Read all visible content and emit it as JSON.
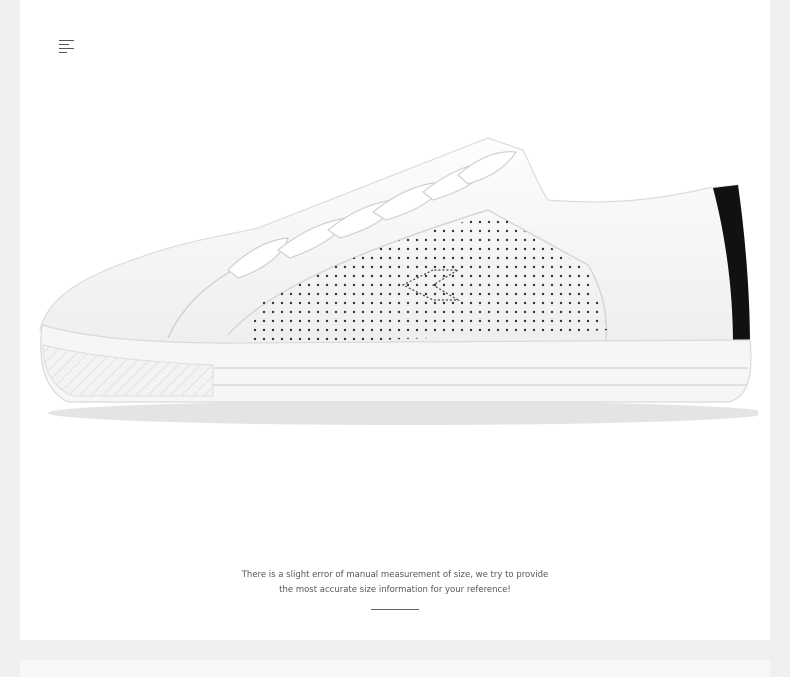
{
  "menu": {
    "icon": "hamburger-menu-icon"
  },
  "product_image": {
    "subject": "white-sneaker-image",
    "accent_color": "#111111",
    "body_color": "#ffffff"
  },
  "caption": {
    "line1": "There is a slight error of manual measurement of size, we try to provide",
    "line2": "the most accurate size information for your reference!"
  },
  "colors": {
    "page_background": "#efefef",
    "card_background": "#ffffff",
    "caption_text": "#555555"
  }
}
